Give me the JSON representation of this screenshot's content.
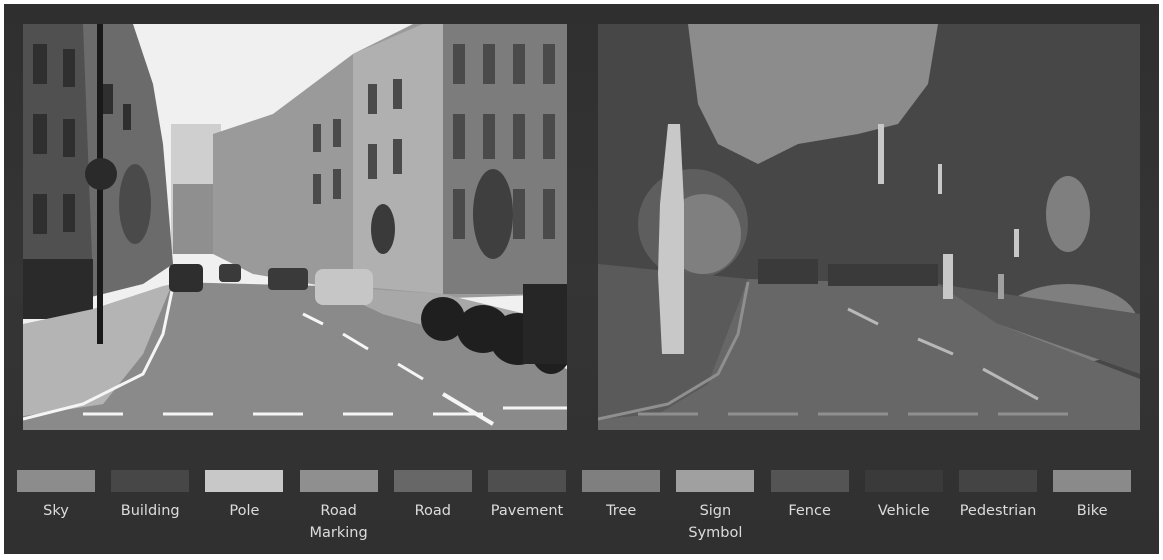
{
  "figure": {
    "background": "#333333",
    "photo": {
      "description_icon": "street-photo",
      "sky_color": "#f0f0f0",
      "road_color": "#8a8a8a"
    },
    "segmentation": {
      "description_icon": "segmentation-map"
    }
  },
  "legend": [
    {
      "label": "Sky",
      "color": "#8c8c8c"
    },
    {
      "label": "Building",
      "color": "#474747"
    },
    {
      "label": "Pole",
      "color": "#c8c8c8"
    },
    {
      "label": "Road\nMarking",
      "color": "#8f8f8f"
    },
    {
      "label": "Road",
      "color": "#676767"
    },
    {
      "label": "Pavement",
      "color": "#4f4f4f"
    },
    {
      "label": "Tree",
      "color": "#7f7f7f"
    },
    {
      "label": "Sign\nSymbol",
      "color": "#a0a0a0"
    },
    {
      "label": "Fence",
      "color": "#545454"
    },
    {
      "label": "Vehicle",
      "color": "#3a3a3a"
    },
    {
      "label": "Pedestrian",
      "color": "#444444"
    },
    {
      "label": "Bike",
      "color": "#8a8a8a"
    }
  ]
}
